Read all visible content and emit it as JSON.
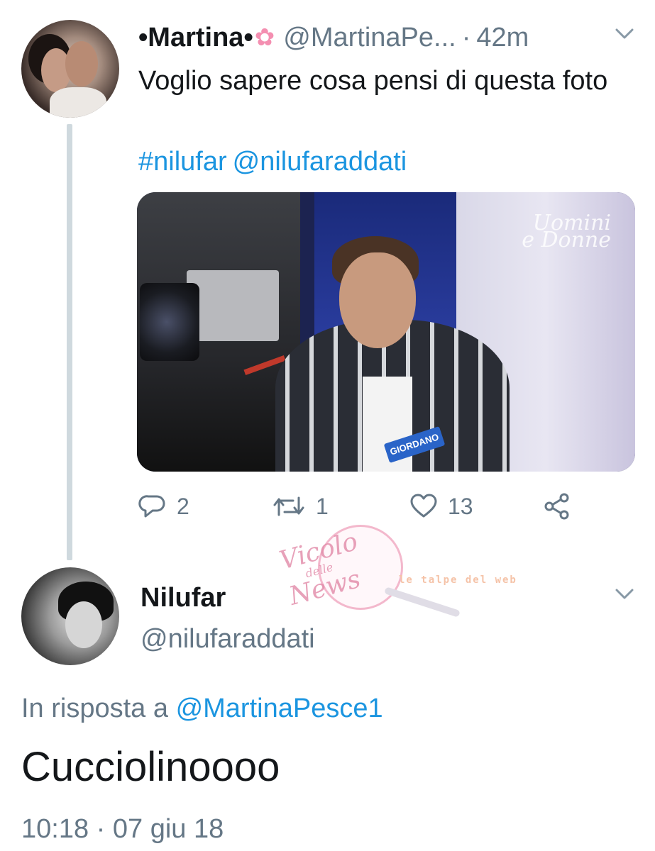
{
  "tweet": {
    "display_name": "•Martina•",
    "flower_icon": "cherry-blossom-icon",
    "handle": "@MartinaPe...",
    "separator": "·",
    "time": "42m",
    "text": "Voglio sapere cosa pensi di questa foto",
    "hashtag": "#nilufar",
    "mention": "@nilufaraddati",
    "media": {
      "logo_line1": "Uomini",
      "logo_line2": "e Donne",
      "name_tag": "GIORDANO"
    },
    "actions": {
      "reply_count": "2",
      "retweet_count": "1",
      "like_count": "13"
    }
  },
  "reply": {
    "display_name": "Nilufar",
    "handle": "@nilufaraddati",
    "in_reply_prefix": "In risposta a",
    "in_reply_mention": "@MartinaPesce1",
    "text": "Cucciolinoooo",
    "timestamp": "10:18 · 07 giu 18"
  },
  "watermark": {
    "line1": "Vicolo",
    "line2": "delle",
    "line3": "News",
    "banner": "le talpe del web"
  },
  "colors": {
    "link": "#1b95e0",
    "secondary": "#657786",
    "text": "#14171a",
    "thread_line": "#cfd9de"
  }
}
